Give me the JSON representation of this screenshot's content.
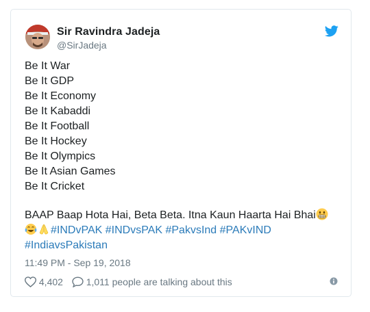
{
  "author": {
    "name": "Sir Ravindra Jadeja",
    "handle": "@SirJadeja"
  },
  "tweet": {
    "lines": [
      "Be It War",
      "Be It GDP",
      "Be It Economy",
      "Be It Kabaddi",
      "Be It Football",
      "Be It Hockey",
      "Be It Olympics",
      "Be It Asian Games",
      "Be It Cricket"
    ],
    "closing": "BAAP Baap Hota Hai, Beta Beta. Itna Kaun Haarta Hai Bhai",
    "hashtags": [
      "#INDvPAK",
      "#INDvsPAK",
      "#PakvsInd",
      "#PAKvIND",
      "#IndiavsPakistan"
    ]
  },
  "timestamp": "11:49 PM - Sep 19, 2018",
  "likes": "4,402",
  "talking": "1,011 people are talking about this",
  "icons": {
    "brand": "twitter-bird-icon",
    "grimace": "grimacing-face-emoji",
    "laugh": "tears-of-joy-emoji",
    "pray": "folded-hands-emoji",
    "like": "heart-icon",
    "reply": "speech-bubble-icon",
    "info": "info-icon"
  },
  "colors": {
    "link": "#2b7bb9",
    "twitter_blue": "#1da1f2",
    "muted": "#697882",
    "text": "#1c2022"
  }
}
